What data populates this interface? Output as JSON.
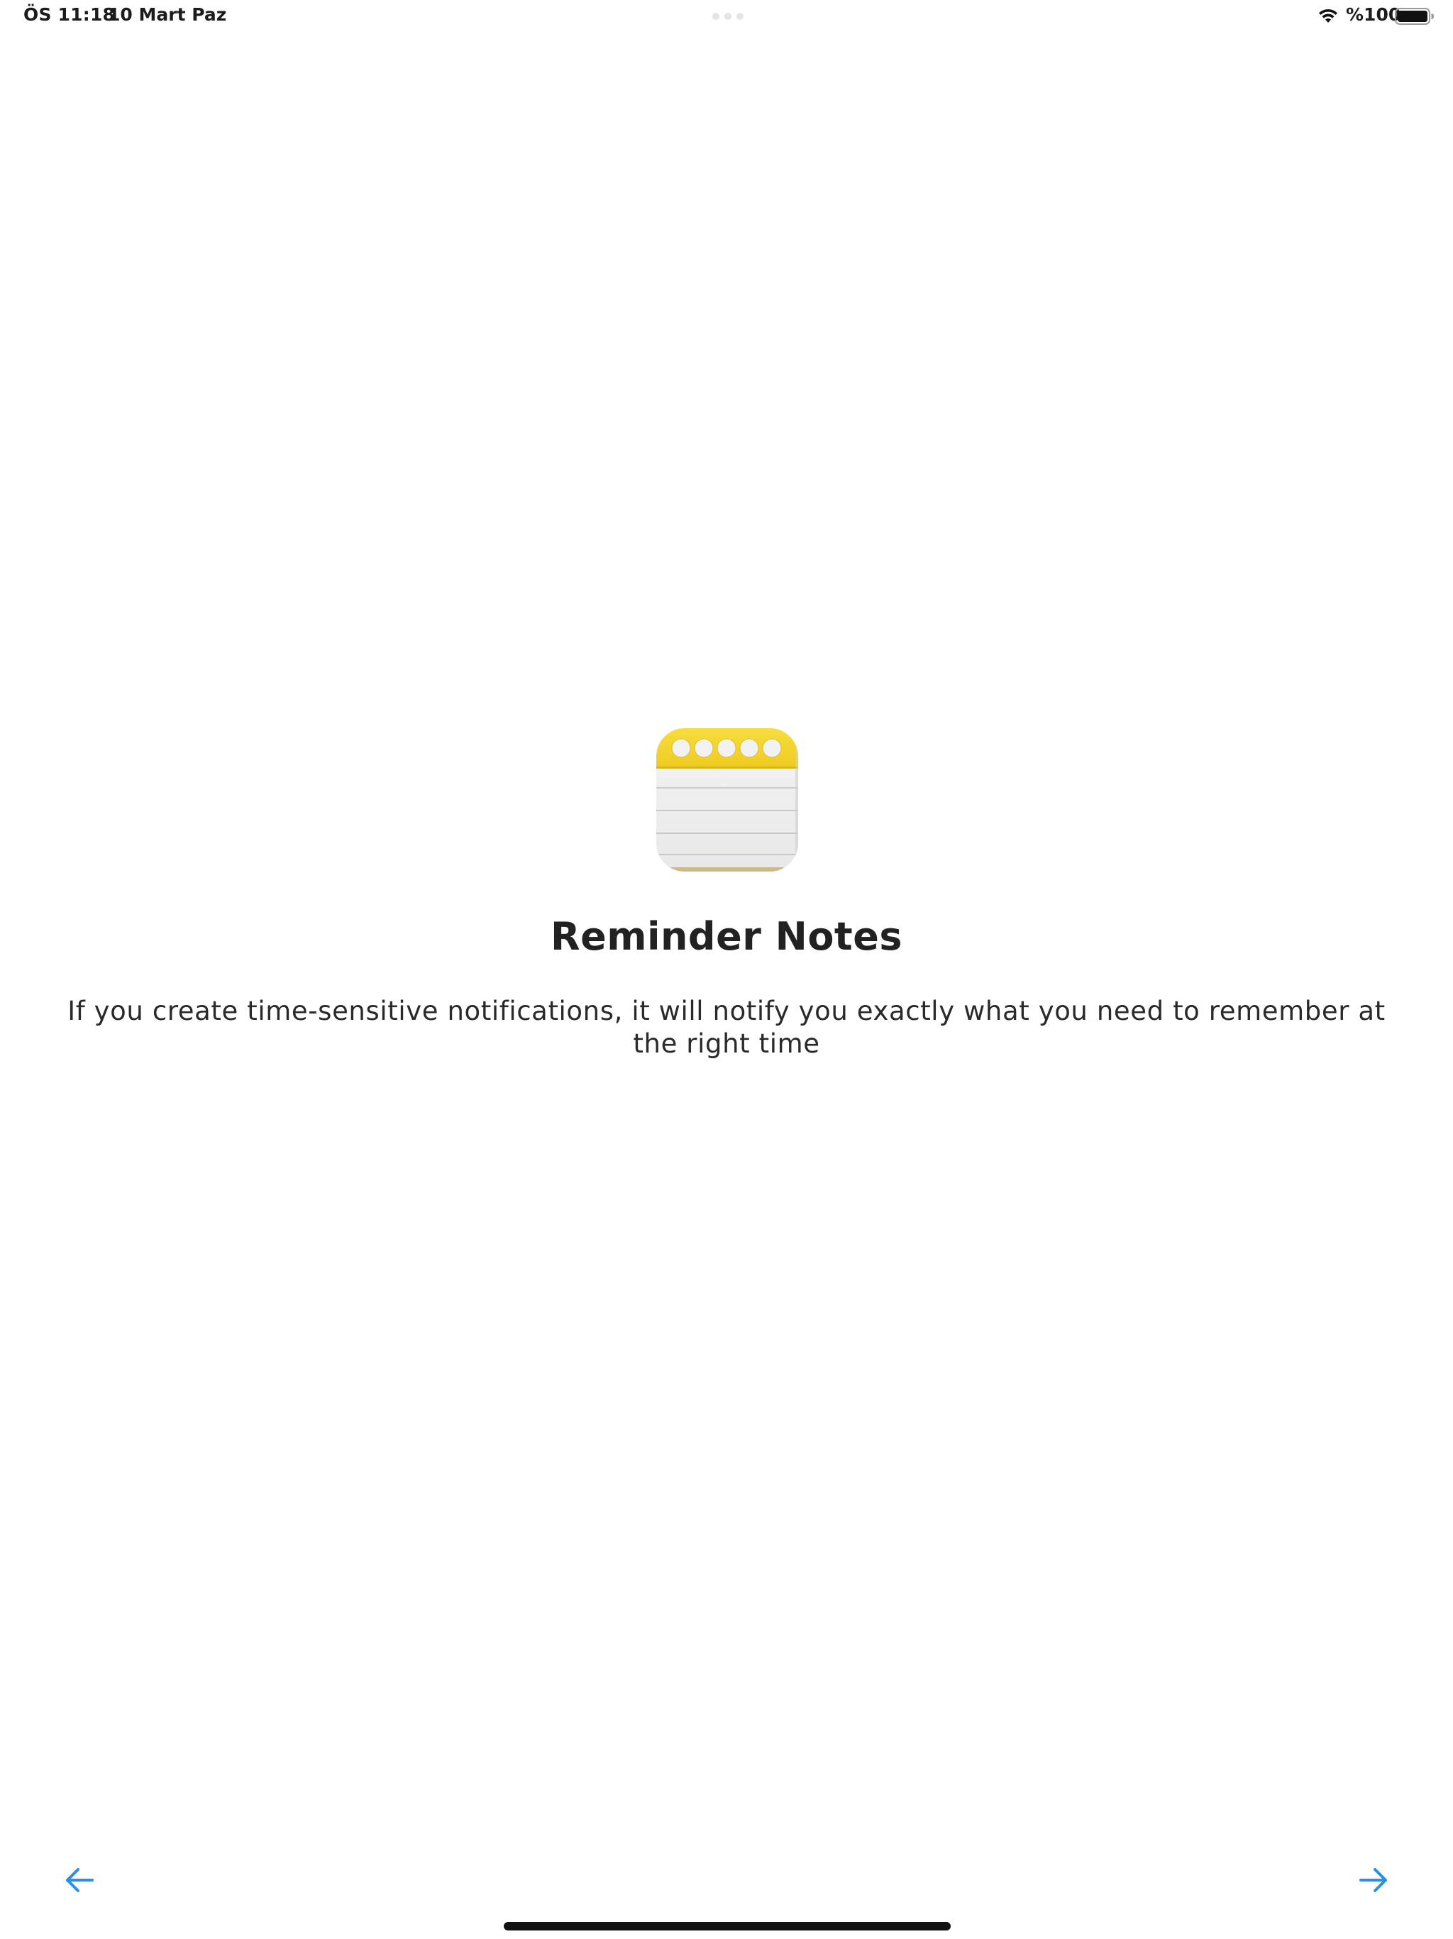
{
  "status_bar": {
    "time": "ÖS 11:18",
    "date": "10 Mart Paz",
    "battery_percent": "%100",
    "battery_level": 1.0,
    "icons": [
      "wifi-icon",
      "battery-icon"
    ]
  },
  "onboarding": {
    "app_icon": "notepad-icon",
    "title": "Reminder Notes",
    "description": "If you create time-sensitive notifications, it will notify you exactly what you need to remember at the right time"
  },
  "navigation": {
    "prev_icon": "arrow-left-icon",
    "next_icon": "arrow-right-icon",
    "accent_color": "#2B8FE3"
  },
  "colors": {
    "icon_header_yellow": "#F4D632",
    "icon_paper": "#EFEFEF",
    "icon_lines": "#B9B9B9",
    "text": "#222222"
  }
}
